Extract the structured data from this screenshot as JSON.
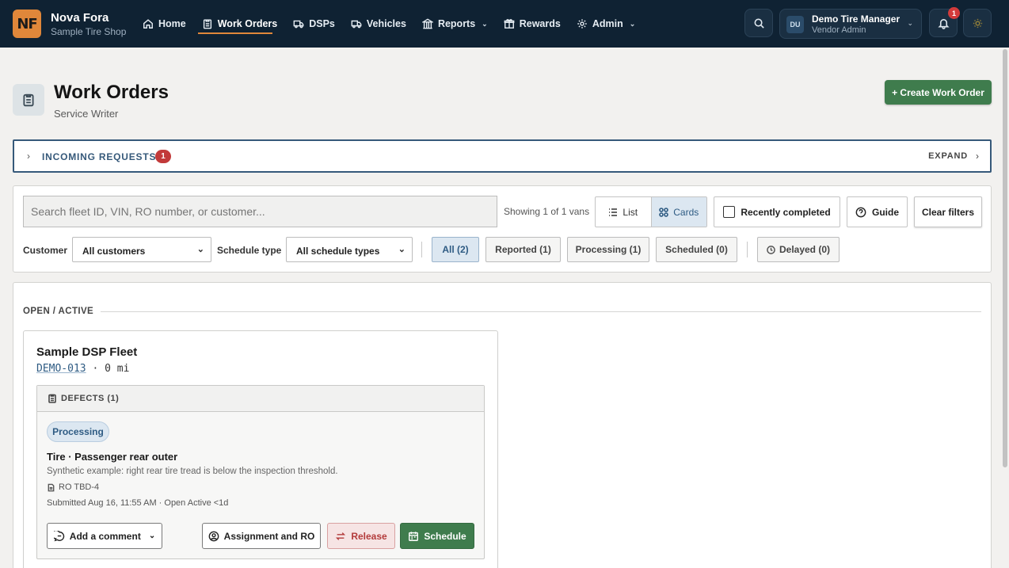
{
  "app": {
    "logo_text": "NF",
    "brand_name": "Nova Fora",
    "brand_sub": "Sample Tire Shop"
  },
  "nav": {
    "items": [
      {
        "label": "Home",
        "icon": "home-icon"
      },
      {
        "label": "Work Orders",
        "icon": "clipboard-icon",
        "active": true
      },
      {
        "label": "DSPs",
        "icon": "truck-icon"
      },
      {
        "label": "Vehicles",
        "icon": "van-icon"
      },
      {
        "label": "Reports",
        "icon": "building-icon",
        "dropdown": true
      },
      {
        "label": "Rewards",
        "icon": "gift-icon"
      },
      {
        "label": "Admin",
        "icon": "gear-icon",
        "dropdown": true
      }
    ]
  },
  "user": {
    "initials": "DU",
    "name": "Demo Tire Manager",
    "role": "Vendor Admin",
    "notification_count": "1"
  },
  "header": {
    "title": "Work Orders",
    "subtitle": "Service Writer",
    "create_label": "+ Create Work Order"
  },
  "incoming": {
    "label": "INCOMING REQUESTS",
    "count": "1",
    "expand_label": "EXPAND"
  },
  "filters": {
    "search_placeholder": "Search fleet ID, VIN, RO number, or customer...",
    "showing": "Showing 1 of 1 vans",
    "view_list": "List",
    "view_cards": "Cards",
    "recently_completed": "Recently completed",
    "guide": "Guide",
    "clear": "Clear filters",
    "customer_label": "Customer",
    "customer_value": "All customers",
    "schedule_label": "Schedule type",
    "schedule_value": "All schedule types",
    "statuses": {
      "all": "All (2)",
      "reported": "Reported (1)",
      "processing": "Processing (1)",
      "scheduled": "Scheduled (0)",
      "delayed": "Delayed (0)"
    }
  },
  "list": {
    "section": "OPEN / ACTIVE",
    "card": {
      "fleet": "Sample DSP Fleet",
      "van_id": "DEMO-013",
      "mileage": " · 0 mi",
      "defects_header": "DEFECTS (1)",
      "status": "Processing",
      "defect_title": "Tire · Passenger rear outer",
      "defect_desc": "Synthetic example: right rear tire tread is below the inspection threshold.",
      "ro": "RO TBD-4",
      "submitted": "Submitted Aug 16, 11:55 AM · Open Active <1d",
      "comment_label": "Add a comment",
      "assign_label": "Assignment and RO",
      "release_label": "Release",
      "schedule_label": "Schedule"
    }
  },
  "colors": {
    "nav_bg": "#0f2233",
    "accent_orange": "#e0873a",
    "primary_green": "#3f7c4d",
    "link_blue": "#2e5b83",
    "danger_red": "#c23a3a"
  }
}
